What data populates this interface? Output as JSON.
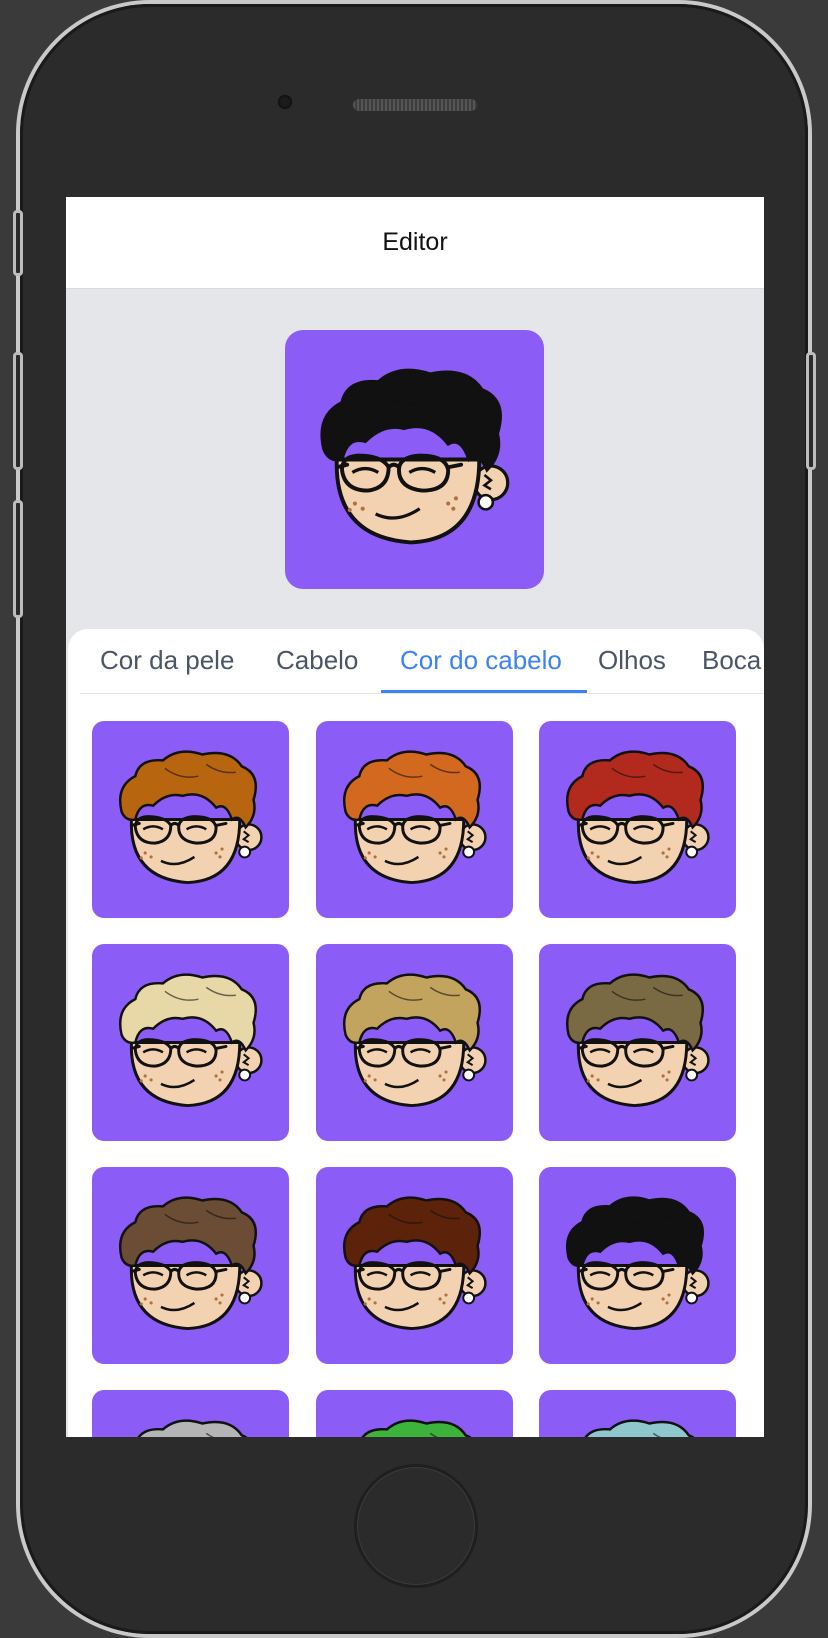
{
  "header": {
    "title": "Editor"
  },
  "preview": {
    "hair_color": "#111111",
    "skin_color": "#f2d2b0",
    "background": "#8b5cf6"
  },
  "tabs": [
    {
      "label": "Cor da pele",
      "active": false
    },
    {
      "label": "Cabelo",
      "active": false
    },
    {
      "label": "Cor do cabelo",
      "active": true
    },
    {
      "label": "Olhos",
      "active": false
    },
    {
      "label": "Boca",
      "active": false
    }
  ],
  "hair_colors": [
    "#b8650f",
    "#d2691e",
    "#b22a1e",
    "#e8d8a8",
    "#c3a45f",
    "#7a6a44",
    "#6b4c35",
    "#5c220a",
    "#111111",
    "#b5b5b5",
    "#3cb43c",
    "#8ec8cc"
  ],
  "colors": {
    "accent": "#3b82f6",
    "tile_background": "#8b5cf6",
    "skin": "#f2d2b0"
  }
}
